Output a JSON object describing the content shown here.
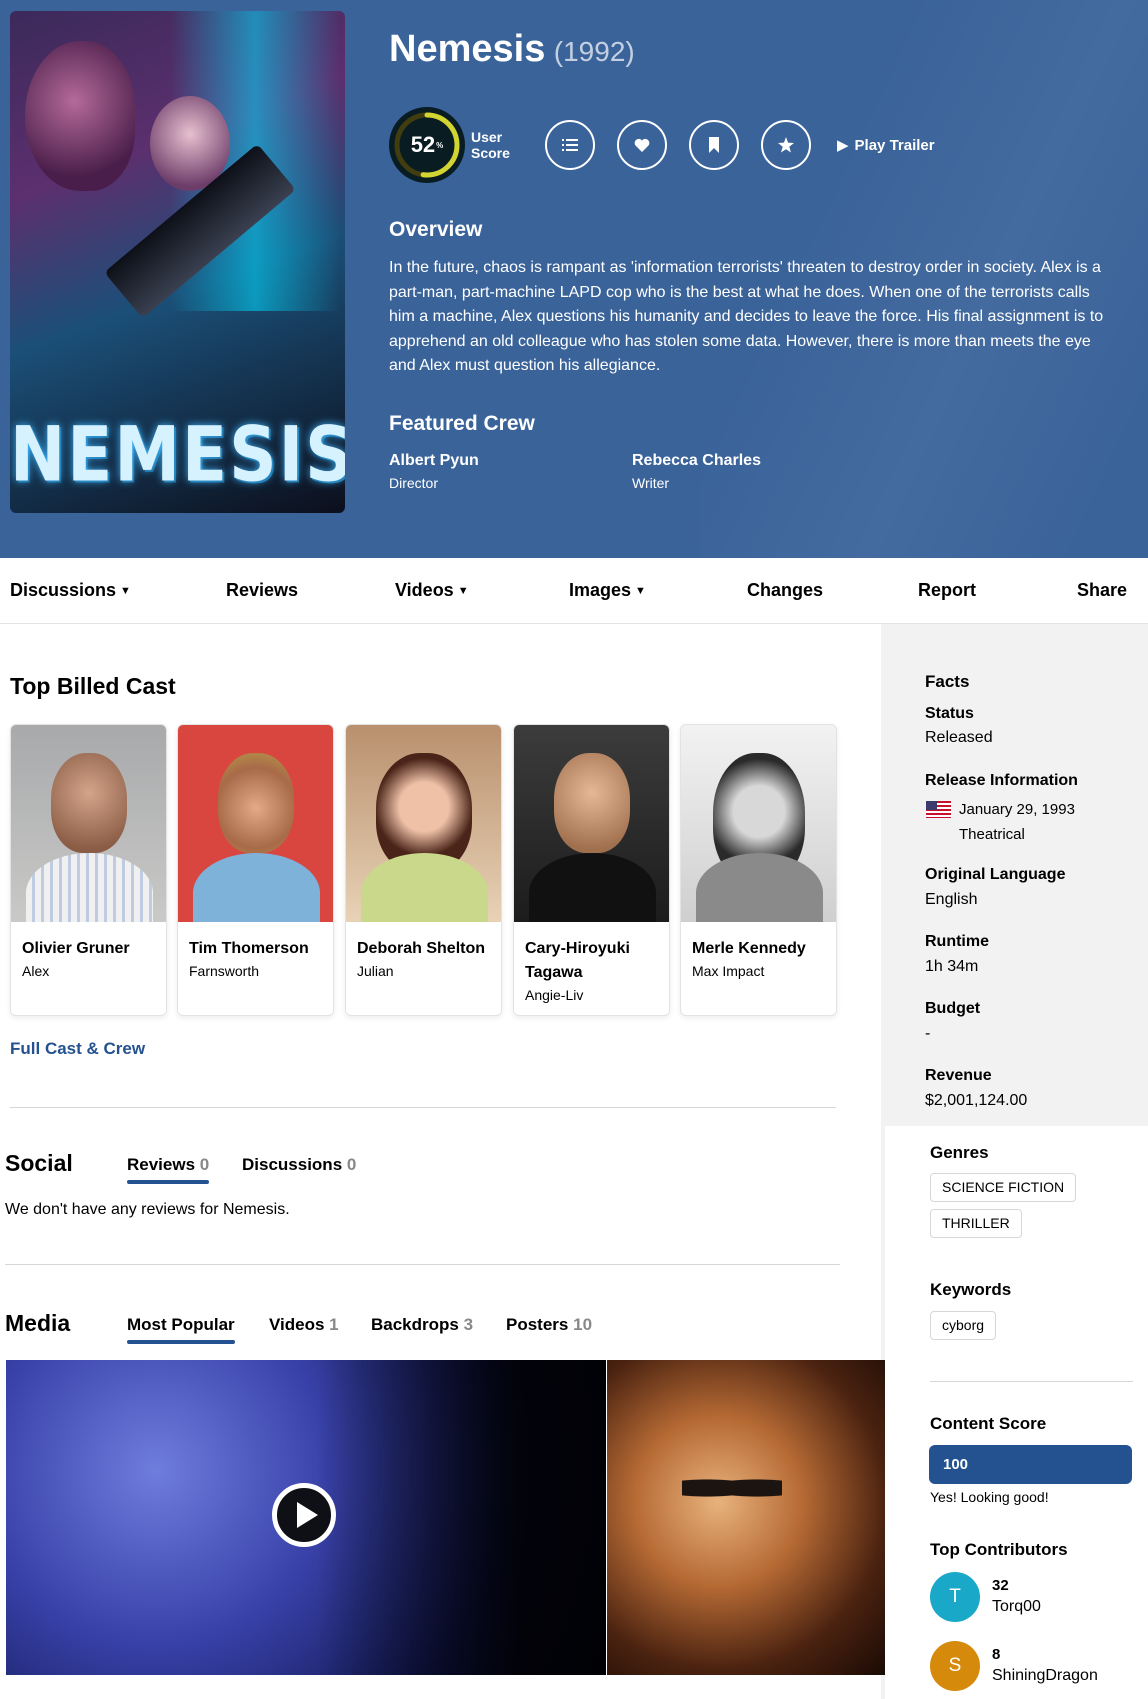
{
  "movie": {
    "title": "Nemesis",
    "year": "(1992)",
    "poster_logo": "NEMESIS",
    "user_score": "52",
    "user_score_value": 0.52,
    "user_score_label": "User Score",
    "play_trailer": "Play Trailer",
    "overview_heading": "Overview",
    "overview": "In the future, chaos is rampant as 'information terrorists' threaten to destroy order in society. Alex is a part-man, part-machine LAPD cop who is the best at what he does. When one of the terrorists calls him a machine, Alex questions his humanity and decides to leave the force. His final assignment is to apprehend an old colleague who has stolen some data. However, there is more than meets the eye and Alex must question his allegiance.",
    "crew_heading": "Featured Crew",
    "crew": [
      {
        "name": "Albert Pyun",
        "role": "Director"
      },
      {
        "name": "Rebecca Charles",
        "role": "Writer"
      }
    ]
  },
  "nav": {
    "discussions": "Discussions",
    "reviews": "Reviews",
    "videos": "Videos",
    "images": "Images",
    "changes": "Changes",
    "report": "Report",
    "share": "Share"
  },
  "cast": {
    "heading": "Top Billed Cast",
    "members": [
      {
        "name": "Olivier Gruner",
        "character": "Alex"
      },
      {
        "name": "Tim Thomerson",
        "character": "Farnsworth"
      },
      {
        "name": "Deborah Shelton",
        "character": "Julian"
      },
      {
        "name": "Cary-Hiroyuki Tagawa",
        "character": "Angie-Liv"
      },
      {
        "name": "Merle Kennedy",
        "character": "Max Impact"
      }
    ],
    "full_link": "Full Cast & Crew"
  },
  "social": {
    "heading": "Social",
    "reviews_label": "Reviews",
    "reviews_count": "0",
    "discussions_label": "Discussions",
    "discussions_count": "0",
    "empty_text": "We don't have any reviews for Nemesis."
  },
  "media": {
    "heading": "Media",
    "tabs": {
      "popular": "Most Popular",
      "videos_label": "Videos",
      "videos_count": "1",
      "backdrops_label": "Backdrops",
      "backdrops_count": "3",
      "posters_label": "Posters",
      "posters_count": "10"
    }
  },
  "facts": {
    "heading": "Facts",
    "status_label": "Status",
    "status": "Released",
    "release_label": "Release Information",
    "release_date": "January 29, 1993",
    "release_type": "Theatrical",
    "language_label": "Original Language",
    "language": "English",
    "runtime_label": "Runtime",
    "runtime": "1h 34m",
    "budget_label": "Budget",
    "budget": "-",
    "revenue_label": "Revenue",
    "revenue": "$2,001,124.00",
    "genres_label": "Genres",
    "genres": [
      "SCIENCE FICTION",
      "THRILLER"
    ],
    "keywords_label": "Keywords",
    "keywords": [
      "cyborg"
    ],
    "content_score_label": "Content Score",
    "content_score": "100",
    "content_score_value": 1.0,
    "content_score_note": "Yes! Looking good!",
    "contributors_label": "Top Contributors",
    "contributors": [
      {
        "initial": "T",
        "count": "32",
        "user": "Torq00",
        "color": "#1aa8c8"
      },
      {
        "initial": "S",
        "count": "8",
        "user": "ShiningDragon",
        "color": "#d68a0c"
      }
    ]
  },
  "colors": {
    "header_bg": "#3a639a",
    "accent": "#245290",
    "score_ring": "#d2d531"
  }
}
